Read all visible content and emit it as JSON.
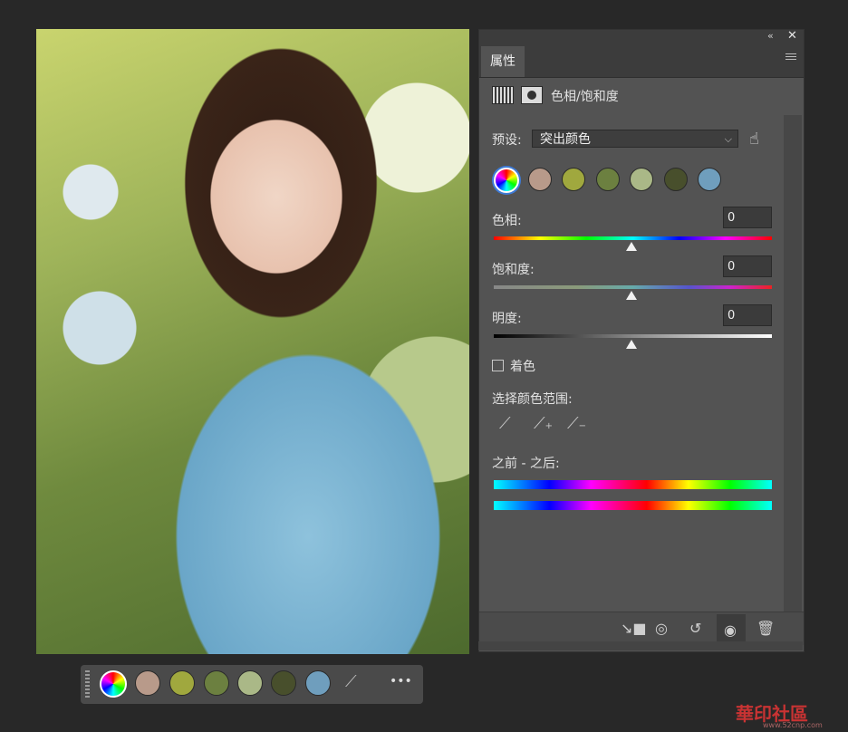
{
  "panel": {
    "tab_label": "属性",
    "collapse_glyph": "«",
    "close_glyph": "✕",
    "title": "色相/饱和度",
    "preset_label": "预设:",
    "preset_value": "突出颜色",
    "hue_label": "色相:",
    "hue_value": "0",
    "saturation_label": "饱和度:",
    "saturation_value": "0",
    "lightness_label": "明度:",
    "lightness_value": "0",
    "colorize_label": "着色",
    "range_label": "选择颜色范围:",
    "before_after_label": "之前 - 之后:"
  },
  "swatches": [
    {
      "name": "master",
      "color": "conic"
    },
    {
      "name": "skin",
      "color": "#b89a8a"
    },
    {
      "name": "olive",
      "color": "#a0a83e"
    },
    {
      "name": "moss",
      "color": "#6c8040"
    },
    {
      "name": "sage",
      "color": "#aab887"
    },
    {
      "name": "dark-olive",
      "color": "#484f2c"
    },
    {
      "name": "sky",
      "color": "#6f9ebd"
    }
  ],
  "quickbar": {
    "more_label": "•••"
  },
  "watermark": {
    "text": "華印社區",
    "url": "www.52cnp.com"
  }
}
